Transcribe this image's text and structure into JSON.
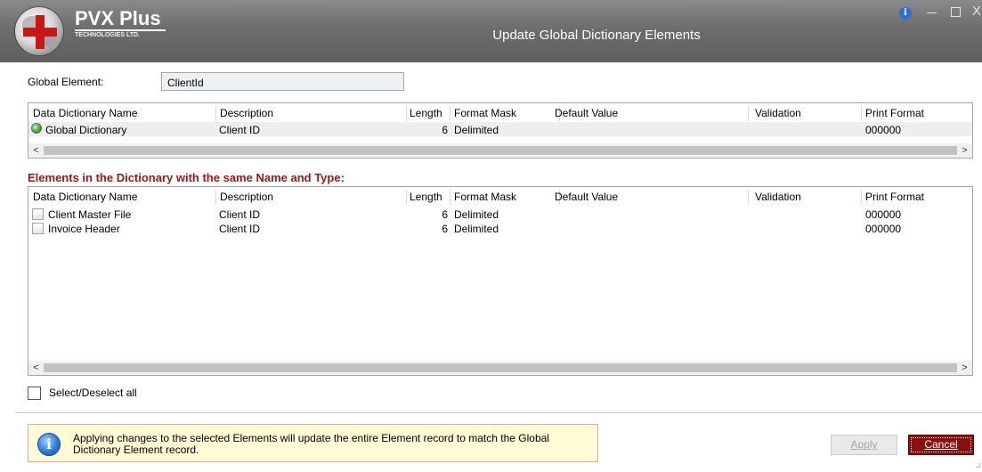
{
  "window": {
    "logo_text": "PVX Plus",
    "logo_subtext": "TECHNOLOGIES LTD.",
    "title": "Update Global Dictionary Elements",
    "close_glyph": "X"
  },
  "global_element": {
    "label": "Global Element:",
    "value": "ClientId"
  },
  "columns": {
    "name": "Data Dictionary Name",
    "description": "Description",
    "length": "Length",
    "format_mask": "Format Mask",
    "default_value": "Default Value",
    "validation": "Validation",
    "print_format": "Print Format"
  },
  "global_grid": {
    "rows": [
      {
        "icon": "globe-icon",
        "name": "Global Dictionary",
        "description": "Client ID",
        "length": "6",
        "format_mask": "Delimited",
        "default_value": "",
        "validation": "",
        "print_format": "000000"
      }
    ]
  },
  "elements_section": {
    "title": "Elements in the Dictionary with the same Name and Type:"
  },
  "elements_grid": {
    "rows": [
      {
        "checked": false,
        "name": "Client Master File",
        "description": "Client ID",
        "length": "6",
        "format_mask": "Delimited",
        "default_value": "",
        "validation": "",
        "print_format": "000000"
      },
      {
        "checked": false,
        "name": "Invoice Header",
        "description": "Client ID",
        "length": "6",
        "format_mask": "Delimited",
        "default_value": "",
        "validation": "",
        "print_format": "000000"
      }
    ]
  },
  "select_all": {
    "label": "Select/Deselect all",
    "checked": false
  },
  "info": {
    "message": "Applying changes to the selected Elements will update the entire Element record to match the Global Dictionary Element record."
  },
  "buttons": {
    "apply": {
      "label": "Apply",
      "enabled": false
    },
    "cancel": {
      "label": "Cancel",
      "enabled": true
    }
  },
  "scroll": {
    "left_arrow": "<",
    "right_arrow": ">"
  },
  "colors": {
    "section_title": "#a31515",
    "cancel_button": "#8c0f0f",
    "info_background": "#fffbd4",
    "info_border": "#f0a5a5",
    "titlebar": "#6d6d6d"
  }
}
